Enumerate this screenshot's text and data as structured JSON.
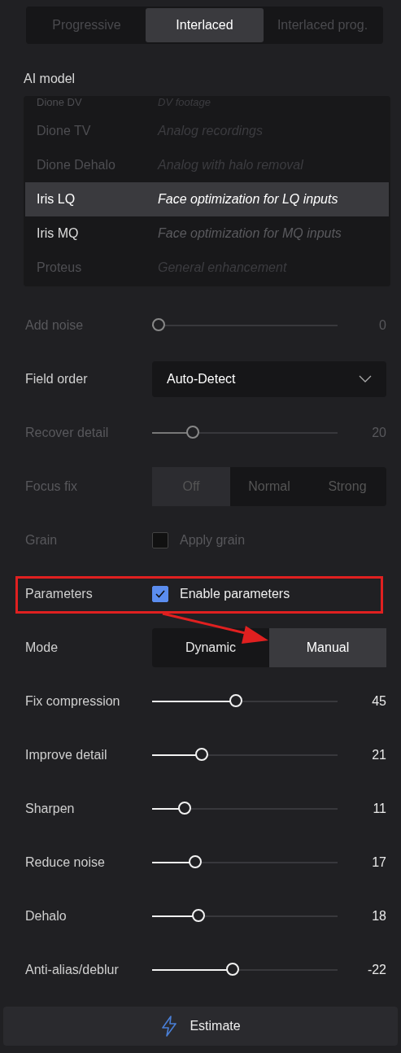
{
  "scan_type": {
    "options": [
      {
        "label": "Progressive",
        "selected": false,
        "dimmed": true
      },
      {
        "label": "Interlaced",
        "selected": true,
        "dimmed": false
      },
      {
        "label": "Interlaced prog.",
        "selected": false,
        "dimmed": true
      }
    ]
  },
  "ai_model": {
    "label": "AI model",
    "models": [
      {
        "name": "Dione DV",
        "description": "DV footage",
        "selected": false,
        "dimmed": true,
        "cut": true
      },
      {
        "name": "Dione TV",
        "description": "Analog recordings",
        "selected": false,
        "dimmed": true,
        "cut": false
      },
      {
        "name": "Dione Dehalo",
        "description": "Analog with halo removal",
        "selected": false,
        "dimmed": true,
        "cut": false
      },
      {
        "name": "Iris LQ",
        "description": "Face optimization for LQ inputs",
        "selected": true,
        "dimmed": false,
        "cut": false
      },
      {
        "name": "Iris MQ",
        "description": "Face optimization for MQ inputs",
        "selected": false,
        "dimmed": false,
        "cut": false
      },
      {
        "name": "Proteus",
        "description": "General enhancement",
        "selected": false,
        "dimmed": true,
        "cut": false
      }
    ]
  },
  "settings": [
    {
      "kind": "slider",
      "label": "Add noise",
      "level": 0,
      "reading": "0",
      "dimmed": true
    },
    {
      "kind": "select",
      "label": "Field order",
      "value": "Auto-Detect",
      "dimmed": false
    },
    {
      "kind": "slider",
      "label": "Recover detail",
      "level": 0.2,
      "reading": "20",
      "dimmed": true
    },
    {
      "kind": "segmented",
      "label": "Focus fix",
      "dimmed": true,
      "options": [
        {
          "label": "Off",
          "selected": true
        },
        {
          "label": "Normal",
          "selected": false
        },
        {
          "label": "Strong",
          "selected": false
        }
      ]
    },
    {
      "kind": "checkbox",
      "label": "Grain",
      "option": "Apply grain",
      "checked": false,
      "dimmed": true
    },
    {
      "kind": "checkbox",
      "label": "Parameters",
      "option": "Enable parameters",
      "checked": true,
      "dimmed": false
    },
    {
      "kind": "segmented",
      "label": "Mode",
      "dimmed": false,
      "options": [
        {
          "label": "Dynamic",
          "selected": false
        },
        {
          "label": "Manual",
          "selected": true
        }
      ]
    },
    {
      "kind": "slider",
      "label": "Fix compression",
      "level": 0.45,
      "reading": "45",
      "dimmed": false
    },
    {
      "kind": "slider",
      "label": "Improve detail",
      "level": 0.25,
      "reading": "21",
      "dimmed": false
    },
    {
      "kind": "slider",
      "label": "Sharpen",
      "level": 0.15,
      "reading": "11",
      "dimmed": false
    },
    {
      "kind": "slider",
      "label": "Reduce noise",
      "level": 0.21,
      "reading": "17",
      "dimmed": false
    },
    {
      "kind": "slider",
      "label": "Dehalo",
      "level": 0.23,
      "reading": "18",
      "dimmed": false
    },
    {
      "kind": "slider",
      "label": "Anti-alias/deblur",
      "level": 0.43,
      "reading": "-22",
      "dimmed": false
    }
  ],
  "callout": {
    "highlight_box": true,
    "arrow": true
  },
  "estimate_button": {
    "label": "Estimate"
  }
}
